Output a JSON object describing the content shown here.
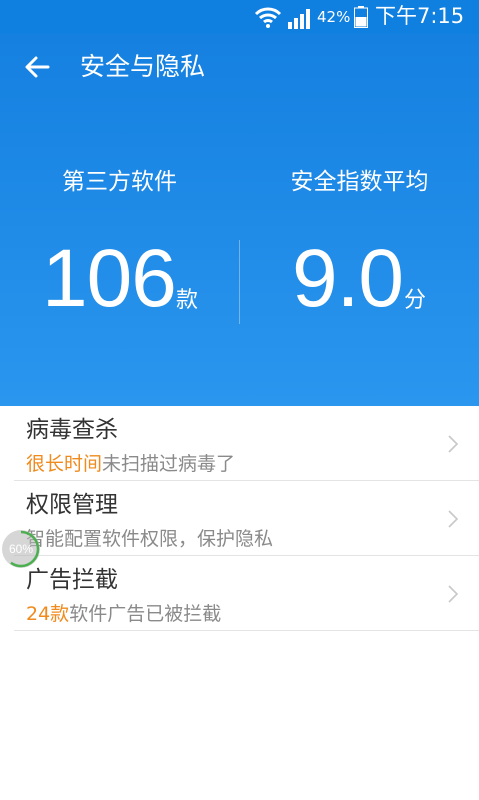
{
  "status_bar": {
    "battery_percent": "42%",
    "time": "下午7:15",
    "icons": [
      "wifi-icon",
      "signal-icon",
      "battery-icon"
    ]
  },
  "header": {
    "title": "安全与隐私",
    "back_icon": "arrow-left-icon"
  },
  "stats": {
    "left": {
      "label": "第三方软件",
      "value": "106",
      "unit": "款"
    },
    "right": {
      "label": "安全指数平均",
      "value": "9.0",
      "unit": "分"
    }
  },
  "list": {
    "items": [
      {
        "title": "病毒查杀",
        "sub_highlight": "很长时间",
        "sub_rest": "未扫描过病毒了"
      },
      {
        "title": "权限管理",
        "sub_highlight": "",
        "sub_rest": "智能配置软件权限，保护隐私"
      },
      {
        "title": "广告拦截",
        "sub_highlight": "24款",
        "sub_rest": "软件广告已被拦截"
      }
    ]
  },
  "float_ball": {
    "label": "60%",
    "progress": 0.6
  },
  "colors": {
    "header_blue": "#1580e0",
    "highlight_orange": "#f08a1c",
    "progress_green": "#4caf50"
  }
}
